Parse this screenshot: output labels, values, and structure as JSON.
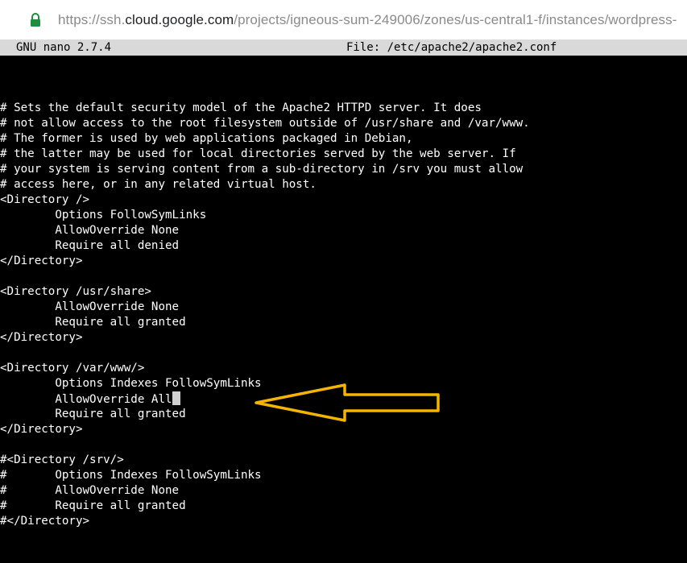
{
  "browser": {
    "url_prefix": "https://ssh.",
    "url_host": "cloud.google.com",
    "url_path": "/projects/igneous-sum-249006/zones/us-central1-f/instances/wordpress-"
  },
  "nano": {
    "version": "GNU nano 2.7.4",
    "file": "File: /etc/apache2/apache2.conf"
  },
  "editor": {
    "lines": [
      "# Sets the default security model of the Apache2 HTTPD server. It does",
      "# not allow access to the root filesystem outside of /usr/share and /var/www.",
      "# The former is used by web applications packaged in Debian,",
      "# the latter may be used for local directories served by the web server. If",
      "# your system is serving content from a sub-directory in /srv you must allow",
      "# access here, or in any related virtual host.",
      "<Directory />",
      "        Options FollowSymLinks",
      "        AllowOverride None",
      "        Require all denied",
      "</Directory>",
      "",
      "<Directory /usr/share>",
      "        AllowOverride None",
      "        Require all granted",
      "</Directory>",
      "",
      "<Directory /var/www/>",
      "        Options Indexes FollowSymLinks",
      "        AllowOverride All",
      "        Require all granted",
      "</Directory>",
      "",
      "#<Directory /srv/>",
      "#       Options Indexes FollowSymLinks",
      "#       AllowOverride None",
      "#       Require all granted",
      "#</Directory>"
    ]
  },
  "colors": {
    "terminal_bg": "#000000",
    "terminal_fg": "#ffffff",
    "header_bg": "#d9d9d9",
    "lock": "#1e8e3e",
    "arrow": "#f4b400"
  },
  "icons": {
    "lock": "lock-icon",
    "arrow": "arrow-annotation"
  }
}
